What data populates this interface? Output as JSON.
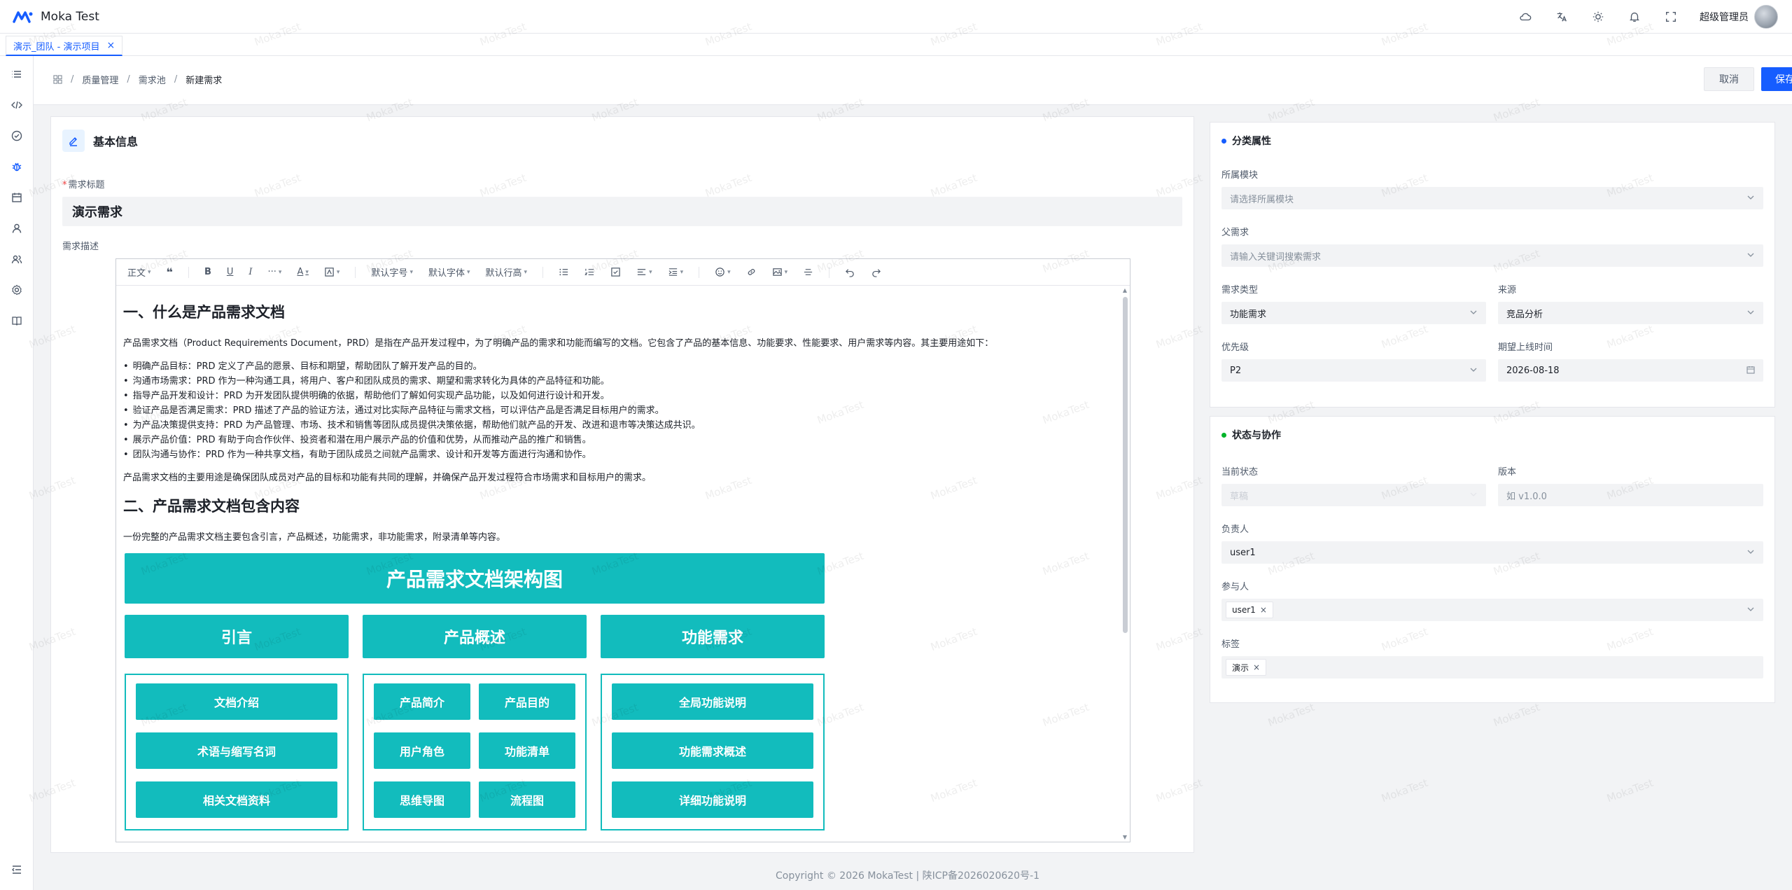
{
  "app": {
    "title": "Moka Test"
  },
  "header": {
    "user_name": "超级管理员"
  },
  "tabs": [
    {
      "label": "演示_团队 - 演示项目",
      "close": "×"
    }
  ],
  "breadcrumb": {
    "home_icon": "grid-icon",
    "items": [
      "质量管理",
      "需求池",
      "新建需求"
    ],
    "sep": "/"
  },
  "actions": {
    "cancel": "取消",
    "save": "保存"
  },
  "basic": {
    "title": "基本信息",
    "req_title_label": "需求标题",
    "req_title_value": "演示需求",
    "desc_label": "需求描述"
  },
  "toolbar": {
    "paragraph": "正文",
    "font_size": "默认字号",
    "font_family": "默认字体",
    "line_height": "默认行高"
  },
  "doc": {
    "h1": "一、什么是产品需求文档",
    "intro": "产品需求文档（Product Requirements Document，PRD）是指在产品开发过程中，为了明确产品的需求和功能而编写的文档。它包含了产品的基本信息、功能要求、性能要求、用户需求等内容。其主要用途如下：",
    "bullets": [
      "明确产品目标：PRD 定义了产品的愿景、目标和期望，帮助团队了解开发产品的目的。",
      "沟通市场需求：PRD 作为一种沟通工具，将用户、客户和团队成员的需求、期望和需求转化为具体的产品特征和功能。",
      "指导产品开发和设计：PRD 为开发团队提供明确的依据，帮助他们了解如何实现产品功能，以及如何进行设计和开发。",
      "验证产品是否满足需求：PRD 描述了产品的验证方法，通过对比实际产品特征与需求文档，可以评估产品是否满足目标用户的需求。",
      "为产品决策提供支持：PRD 为产品管理、市场、技术和销售等团队成员提供决策依据，帮助他们就产品的开发、改进和退市等决策达成共识。",
      "展示产品价值：PRD 有助于向合作伙伴、投资者和潜在用户展示产品的价值和优势，从而推动产品的推广和销售。",
      "团队沟通与协作：PRD 作为一种共享文档，有助于团队成员之间就产品需求、设计和开发等方面进行沟通和协作。"
    ],
    "summary": "产品需求文档的主要用途是确保团队成员对产品的目标和功能有共同的理解，并确保产品开发过程符合市场需求和目标用户的需求。",
    "h2": "二、产品需求文档包含内容",
    "p2": "一份完整的产品需求文档主要包含引言，产品概述，功能需求，非功能需求，附录清单等内容。",
    "arch": {
      "title": "产品需求文档架构图",
      "cat1": "引言",
      "cat2": "产品概述",
      "cat3": "功能需求",
      "col1": [
        "文档介绍",
        "术语与缩写名词",
        "相关文档资料"
      ],
      "col2": [
        "产品简介",
        "产品目的",
        "用户角色",
        "功能清单",
        "思维导图",
        "流程图"
      ],
      "col3": [
        "全局功能说明",
        "功能需求概述",
        "详细功能说明"
      ]
    }
  },
  "classify": {
    "title": "分类属性",
    "module_label": "所属模块",
    "module_ph": "请选择所属模块",
    "parent_label": "父需求",
    "parent_ph": "请输入关键词搜索需求",
    "type_label": "需求类型",
    "type_value": "功能需求",
    "source_label": "来源",
    "source_value": "竞品分析",
    "priority_label": "优先级",
    "priority_value": "P2",
    "date_label": "期望上线时间",
    "date_value": "2026-08-18"
  },
  "status": {
    "title": "状态与协作",
    "state_label": "当前状态",
    "state_value": "草稿",
    "version_label": "版本",
    "version_ph": "如 v1.0.0",
    "owner_label": "负责人",
    "owner_value": "user1",
    "participants_label": "参与人",
    "participant_tag": "user1",
    "tags_label": "标签",
    "tag_value": "演示",
    "tag_x": "×"
  },
  "footer": {
    "text": "Copyright © 2026 MokaTest | 陕ICP备2026020620号-1"
  },
  "watermark": "MokaTest",
  "colors": {
    "accent": "#165dff",
    "teal": "#12bcbd",
    "green": "#00b42a"
  }
}
